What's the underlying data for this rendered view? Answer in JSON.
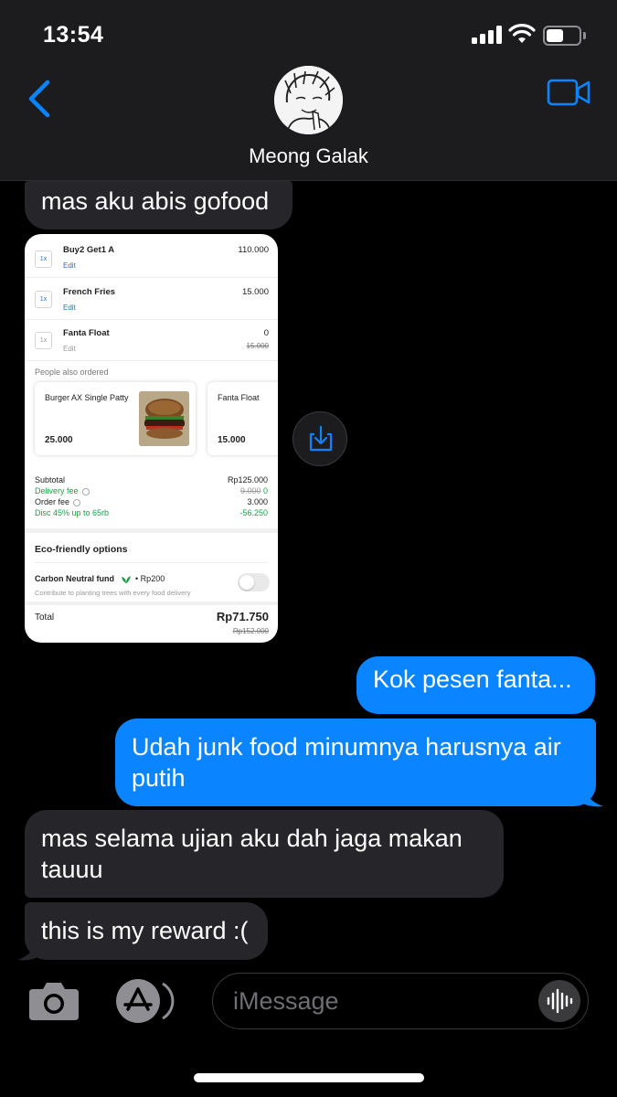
{
  "status_bar": {
    "time": "13:54",
    "battery_level": 0.4
  },
  "header": {
    "contact_name": "Meong Galak",
    "icons": [
      "chevron-left-icon",
      "avatar",
      "video-camera-icon"
    ],
    "accent_color": "#0a84ff"
  },
  "messages": [
    {
      "from": "contact",
      "text": "mas aku abis gofood"
    },
    {
      "from": "contact",
      "type": "image"
    },
    {
      "from": "me",
      "text": "Kok pesen fanta..."
    },
    {
      "from": "me",
      "text": "Udah junk food minumnya harusnya air putih"
    },
    {
      "from": "contact",
      "text": "mas selama ujian aku dah jaga makan tauuu"
    },
    {
      "from": "contact",
      "text": "this is my reward :("
    }
  ],
  "order": {
    "items": [
      {
        "qty": "1x",
        "name": "Buy2 Get1 A",
        "action": "Edit",
        "price": "110.000",
        "old_price": ""
      },
      {
        "qty": "1x",
        "name": "French Fries",
        "action": "Edit",
        "price": "15.000",
        "old_price": ""
      },
      {
        "qty": "1x",
        "name": "Fanta Float",
        "action": "Edit",
        "price": "0",
        "old_price": "15.000"
      }
    ],
    "also_ordered_label": "People also ordered",
    "suggestions": [
      {
        "name": "Burger AX Single Patty",
        "price": "25.000"
      },
      {
        "name": "Fanta Float",
        "price": "15.000"
      }
    ],
    "summary": {
      "subtotal_label": "Subtotal",
      "subtotal_value": "Rp125.000",
      "delivery_label": "Delivery fee",
      "delivery_old": "9.000",
      "delivery_value": "0",
      "order_fee_label": "Order fee",
      "order_fee_value": "3.000",
      "discount_label": "Disc 45% up to 65rb",
      "discount_value": "-56.250"
    },
    "eco_title": "Eco-friendly options",
    "carbon_label": "Carbon Neutral fund",
    "carbon_price": "• Rp200",
    "carbon_desc": "Contribute to planting trees with every food delivery",
    "carbon_enabled": false,
    "total_label": "Total",
    "total_value": "Rp71.750",
    "total_old": "Rp152.000"
  },
  "input_bar": {
    "placeholder": "iMessage"
  }
}
